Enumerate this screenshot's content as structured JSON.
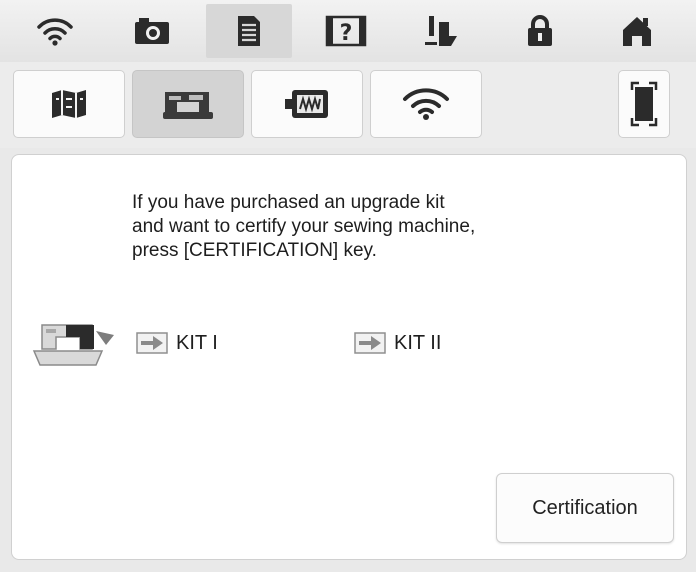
{
  "topbar": {
    "icons": [
      "wifi-icon",
      "camera-icon",
      "document-icon",
      "help-icon",
      "presser-foot-icon",
      "lock-icon",
      "home-icon"
    ],
    "active": "document-icon"
  },
  "tabs": {
    "icons": [
      "map-icon",
      "sewing-machine-icon",
      "embroidery-frame-icon",
      "wifi-icon"
    ],
    "active": "sewing-machine-icon",
    "extra_icon": "fullscreen-icon"
  },
  "panel": {
    "message_lines": [
      "If you have purchased an upgrade kit",
      "and want to certify your sewing machine,",
      "press [CERTIFICATION] key."
    ],
    "kits": [
      {
        "label": "KIT I",
        "icon": "arrow-key-icon"
      },
      {
        "label": "KIT II",
        "icon": "arrow-key-icon"
      }
    ],
    "certification_label": "Certification"
  },
  "colors": {
    "icon": "#2b2b2b",
    "active_background": "#d3d3d3",
    "panel_background": "#ffffff"
  }
}
